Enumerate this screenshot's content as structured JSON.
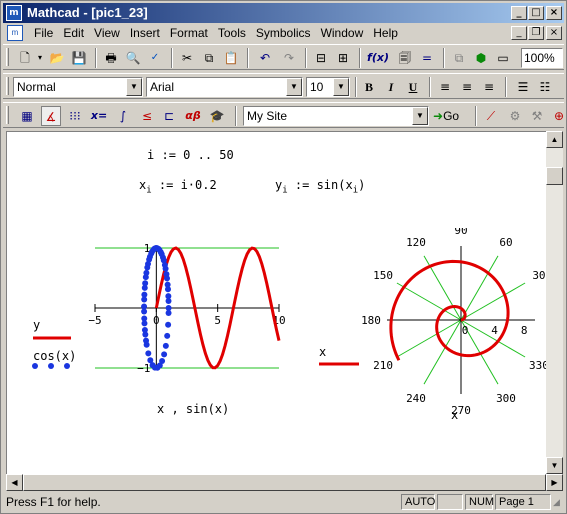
{
  "window": {
    "title": "Mathcad - [pic1_23]",
    "app_icon": "m"
  },
  "menu": {
    "items": [
      "File",
      "Edit",
      "View",
      "Insert",
      "Format",
      "Tools",
      "Symbolics",
      "Window",
      "Help"
    ]
  },
  "toolbar": {
    "zoom": "100%",
    "style": "Normal",
    "font": "Arial",
    "font_size": "10",
    "bold": "B",
    "italic": "I",
    "underline": "U",
    "site": "My Site",
    "go": "Go",
    "func": "f(x)",
    "eq": "x=",
    "greek": "αβ"
  },
  "worksheet": {
    "range_def": {
      "var": "i",
      "op": ":=",
      "expr": "0 .. 50"
    },
    "x_def": {
      "lhs": "x",
      "sub": "i",
      "op": ":=",
      "expr": "i·0.2"
    },
    "y_def": {
      "lhs": "y",
      "sub": "i",
      "op": ":=",
      "expr": "sin(x",
      "sub2": "i",
      "tail": ")"
    }
  },
  "chart_data": [
    {
      "type": "line",
      "x": [
        0.0,
        0.2,
        0.4,
        0.6,
        0.8,
        1.0,
        1.2,
        1.4,
        1.6,
        1.8,
        2.0,
        2.2,
        2.4,
        2.6,
        2.8,
        3.0,
        3.2,
        3.4,
        3.6,
        3.8,
        4.0,
        4.2,
        4.4,
        4.6,
        4.8,
        5.0,
        5.2,
        5.4,
        5.6,
        5.8,
        6.0,
        6.2,
        6.4,
        6.6,
        6.8,
        7.0,
        7.2,
        7.4,
        7.6,
        7.8,
        8.0,
        8.2,
        8.4,
        8.6,
        8.8,
        9.0,
        9.2,
        9.4,
        9.6,
        9.8,
        10.0
      ],
      "series": [
        {
          "name": "y",
          "style": "line",
          "color": "#e00000",
          "x_of": "x",
          "y_of": "sin(x)"
        },
        {
          "name": "cos(x)",
          "style": "dots",
          "color": "#1a36e0",
          "x_of": "cos(x)",
          "y_of": "sin(x)"
        }
      ],
      "xlabel": "x , sin(x)",
      "xlim": [
        -5,
        10
      ],
      "ylim": [
        -1,
        1
      ],
      "x_ticks": [
        "−5",
        "0",
        "5",
        "10"
      ],
      "y_ticks": [
        "1",
        "−1"
      ],
      "grid_color": "#20c020"
    },
    {
      "type": "line",
      "polar": true,
      "series": [
        {
          "name": "x",
          "color": "#e00000",
          "r_of": "x",
          "theta_of": "x"
        }
      ],
      "theta_from_to": [
        0,
        10
      ],
      "r_ticks": [
        "0",
        "4",
        "8"
      ],
      "angle_ticks": [
        "0",
        "30",
        "60",
        "90",
        "120",
        "150",
        "180",
        "210",
        "240",
        "270",
        "300",
        "330"
      ],
      "xlabel": "x",
      "rlim": [
        0,
        10
      ]
    }
  ],
  "status": {
    "help": "Press F1 for help.",
    "auto": "AUTO",
    "num": "NUM",
    "page": "Page 1"
  }
}
